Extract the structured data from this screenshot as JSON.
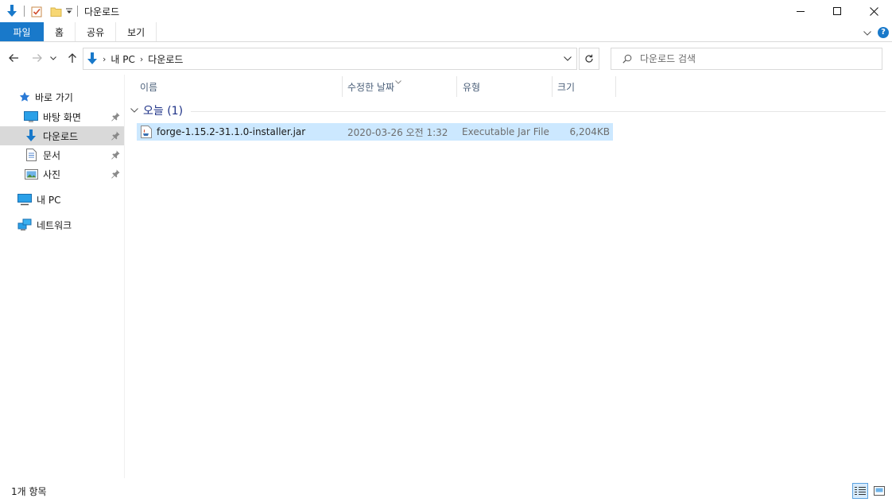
{
  "window": {
    "title": "다운로드"
  },
  "ribbon": {
    "tabs": [
      "파일",
      "홈",
      "공유",
      "보기"
    ]
  },
  "address": {
    "crumbs": [
      "내 PC",
      "다운로드"
    ]
  },
  "search": {
    "placeholder": "다운로드 검색"
  },
  "nav": {
    "quick_access": "바로 가기",
    "items": [
      {
        "label": "바탕 화면",
        "icon": "desktop-icon",
        "pinned": true
      },
      {
        "label": "다운로드",
        "icon": "download-icon",
        "pinned": true,
        "selected": true
      },
      {
        "label": "문서",
        "icon": "document-icon",
        "pinned": true
      },
      {
        "label": "사진",
        "icon": "pictures-icon",
        "pinned": true
      }
    ],
    "this_pc": "내 PC",
    "network": "네트워크"
  },
  "columns": {
    "name": "이름",
    "date": "수정한 날짜",
    "type": "유형",
    "size": "크기"
  },
  "group": {
    "label": "오늘 (1)"
  },
  "files": [
    {
      "name": "forge-1.15.2-31.1.0-installer.jar",
      "date": "2020-03-26 오전 1:32",
      "type": "Executable Jar File",
      "size": "6,204KB"
    }
  ],
  "status": {
    "count": "1개 항목"
  },
  "colors": {
    "accent": "#1979ca",
    "selection": "#cce8ff",
    "group_text": "#1e3287",
    "header_text": "#4c607a"
  }
}
